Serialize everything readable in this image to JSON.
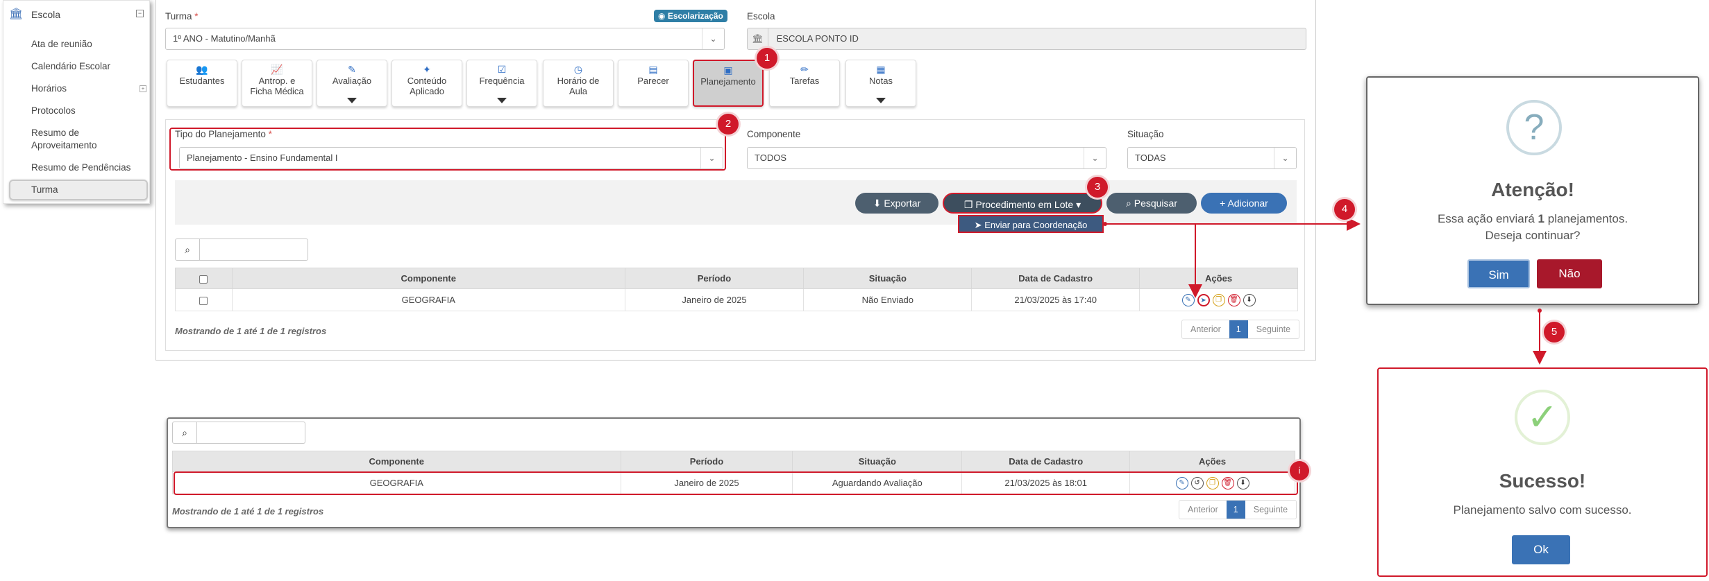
{
  "sidebar": {
    "school": "Escola",
    "items": [
      "Ata de reunião",
      "Calendário Escolar",
      "Horários",
      "Protocolos",
      "Resumo de Aproveitamento",
      "Resumo de Pendências",
      "Turma"
    ]
  },
  "form": {
    "turma_label": "Turma",
    "required_mark": "*",
    "turma_value": "1º ANO - Matutino/Manhã",
    "badge": "Escolarização",
    "escola_label": "Escola",
    "escola_value": "ESCOLA PONTO ID",
    "tipo_label": "Tipo do Planejamento",
    "tipo_value": "Planejamento - Ensino Fundamental I",
    "componente_label": "Componente",
    "componente_value": "TODOS",
    "situacao_label": "Situação",
    "situacao_value": "TODAS"
  },
  "tabs": [
    {
      "line1": "Estudantes",
      "line2": "",
      "icon": "users-icon",
      "glyph": "👥",
      "caret": false
    },
    {
      "line1": "Antrop. e",
      "line2": "Ficha Médica",
      "icon": "chart-icon",
      "glyph": "📈",
      "caret": false
    },
    {
      "line1": "Avaliação",
      "line2": "",
      "icon": "edit-icon",
      "glyph": "✎",
      "caret": true
    },
    {
      "line1": "Conteúdo",
      "line2": "Aplicado",
      "icon": "magic-icon",
      "glyph": "✦",
      "caret": false
    },
    {
      "line1": "Frequência",
      "line2": "",
      "icon": "check-square-icon",
      "glyph": "☑",
      "caret": true
    },
    {
      "line1": "Horário de",
      "line2": "Aula",
      "icon": "clock-icon",
      "glyph": "◷",
      "caret": false
    },
    {
      "line1": "Parecer",
      "line2": "",
      "icon": "file-icon",
      "glyph": "▤",
      "caret": false
    },
    {
      "line1": "Planejamento",
      "line2": "",
      "icon": "book-icon",
      "glyph": "▣",
      "caret": false
    },
    {
      "line1": "Tarefas",
      "line2": "",
      "icon": "pencil-icon",
      "glyph": "✏",
      "caret": false
    },
    {
      "line1": "Notas",
      "line2": "",
      "icon": "list-icon",
      "glyph": "▦",
      "caret": true
    }
  ],
  "toolbar": {
    "export": "Exportar",
    "batch": "Procedimento em Lote",
    "search": "Pesquisar",
    "add": "Adicionar",
    "send": "Enviar para Coordenação"
  },
  "table": {
    "headers": [
      "Componente",
      "Período",
      "Situação",
      "Data de Cadastro",
      "Ações"
    ],
    "row": [
      "GEOGRAFIA",
      "Janeiro de 2025",
      "Não Enviado",
      "21/03/2025 às 17:40"
    ],
    "info": "Mostrando de 1 até 1 de 1 registros"
  },
  "pager": {
    "prev": "Anterior",
    "page": "1",
    "next": "Seguinte"
  },
  "result_table": {
    "row": [
      "GEOGRAFIA",
      "Janeiro de 2025",
      "Aguardando Avaliação",
      "21/03/2025 às 18:01"
    ],
    "info": "Mostrando de 1 até 1 de 1 registros"
  },
  "markers": [
    "1",
    "2",
    "3",
    "4",
    "5",
    "i"
  ],
  "dialog_confirm": {
    "icon": "?",
    "title": "Atenção!",
    "text_pre": "Essa ação enviará ",
    "count": "1",
    "text_post": " planejamentos.",
    "line2": "Deseja continuar?",
    "yes": "Sim",
    "no": "Não"
  },
  "dialog_success": {
    "icon": "✓",
    "title": "Sucesso!",
    "text": "Planejamento salvo com sucesso.",
    "ok": "Ok"
  },
  "colors": {
    "primary": "#3a72b5",
    "danger": "#d0192a",
    "header_dark": "#3d4e5e"
  }
}
